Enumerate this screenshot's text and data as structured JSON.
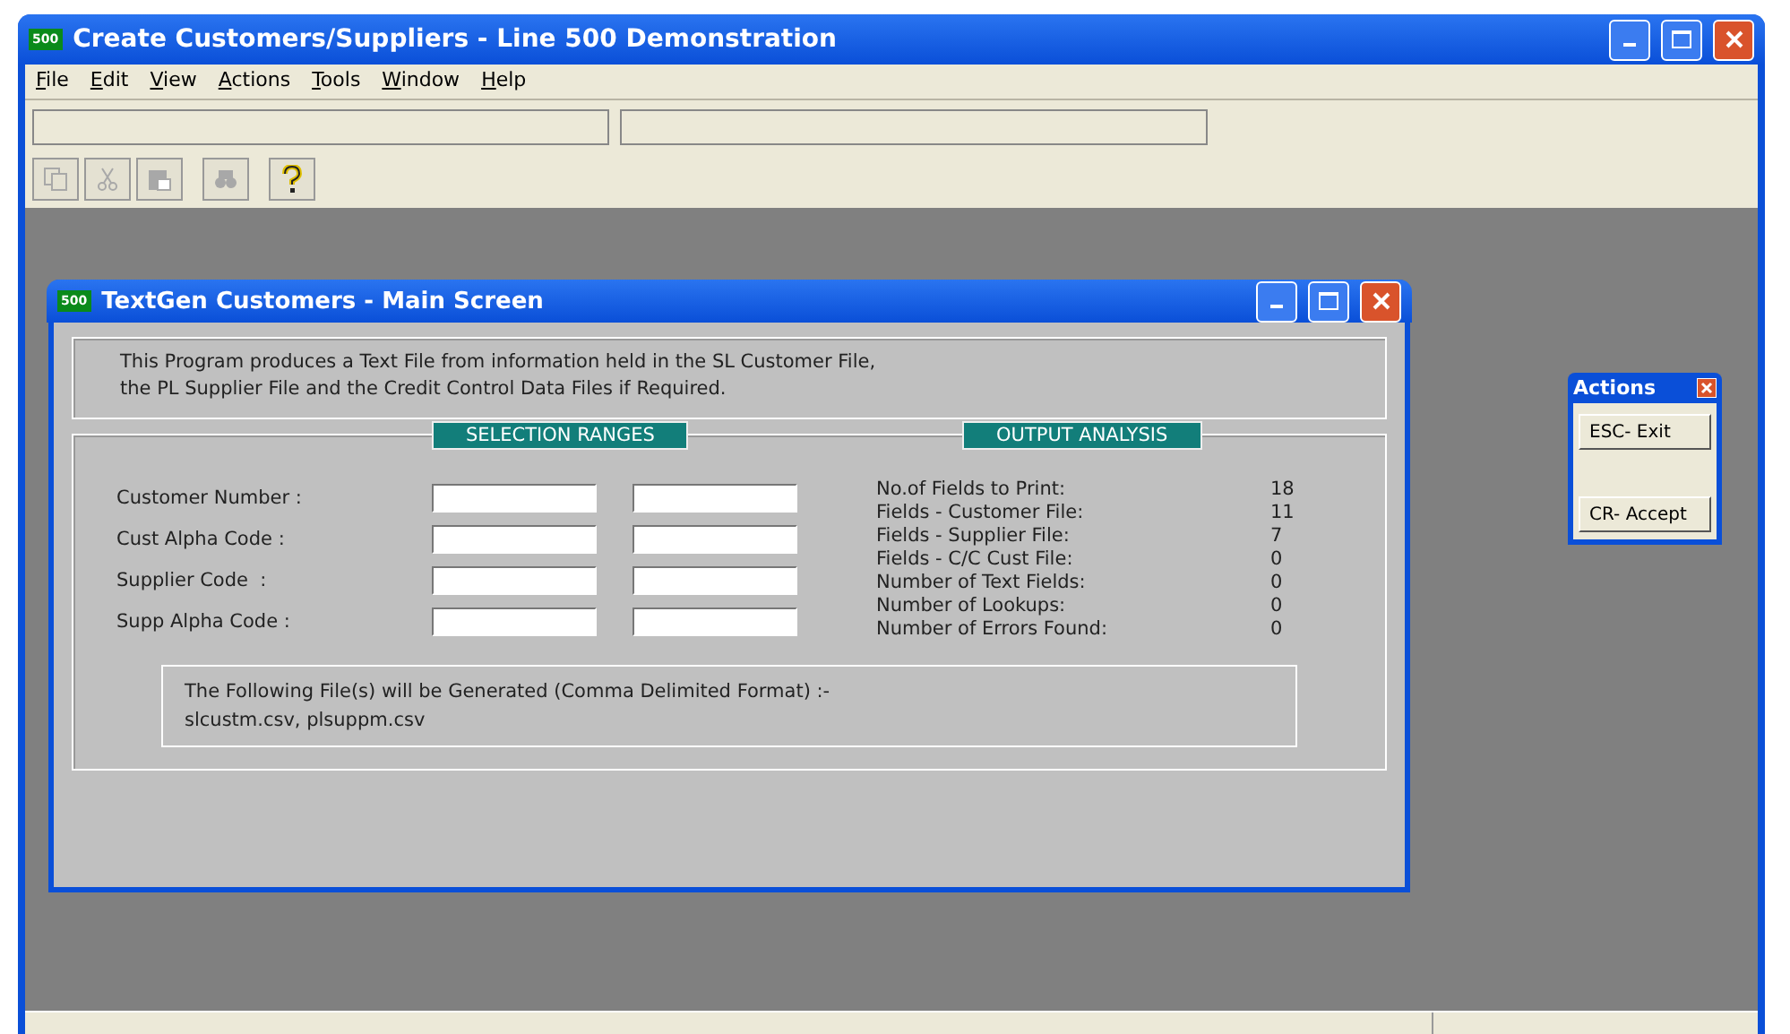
{
  "window": {
    "logo": "500",
    "title": "Create Customers/Suppliers - Line 500 Demonstration"
  },
  "menu": [
    "File",
    "Edit",
    "View",
    "Actions",
    "Tools",
    "Window",
    "Help"
  ],
  "toolbar": [
    {
      "kind": "copy",
      "disabled": true
    },
    {
      "kind": "cut",
      "disabled": true
    },
    {
      "kind": "paste",
      "disabled": true
    },
    {
      "kind": "find",
      "disabled": true
    },
    {
      "kind": "help",
      "disabled": false
    }
  ],
  "child_window": {
    "logo": "500",
    "title": "TextGen Customers - Main Screen",
    "description": "This Program produces a Text File from information held in the SL Customer File, the PL Supplier File and the Credit Control Data Files if Required.",
    "selection_ranges": {
      "heading": "SELECTION RANGES",
      "rows": [
        {
          "label": "Customer Number :"
        },
        {
          "label": "Cust Alpha Code :"
        },
        {
          "label": "Supplier Code  :"
        },
        {
          "label": "Supp Alpha Code :"
        }
      ]
    },
    "output_analysis": {
      "heading": "OUTPUT ANALYSIS",
      "rows": [
        {
          "label": "No.of Fields to Print:",
          "value": "18"
        },
        {
          "label": "Fields - Customer File:",
          "value": "11"
        },
        {
          "label": "Fields - Supplier File:",
          "value": "7"
        },
        {
          "label": "Fields - C/C Cust File:",
          "value": "0"
        },
        {
          "label": "Number of Text Fields:",
          "value": "0"
        },
        {
          "label": "Number of Lookups:",
          "value": "0"
        },
        {
          "label": "Number of Errors Found:",
          "value": "0"
        }
      ]
    },
    "files_caption": "The Following File(s) will be Generated (Comma Delimited Format) :-",
    "files": "slcustm.csv, plsuppm.csv"
  },
  "actions_panel": {
    "title": "Actions",
    "buttons": [
      "ESC- Exit",
      "CR- Accept"
    ]
  }
}
